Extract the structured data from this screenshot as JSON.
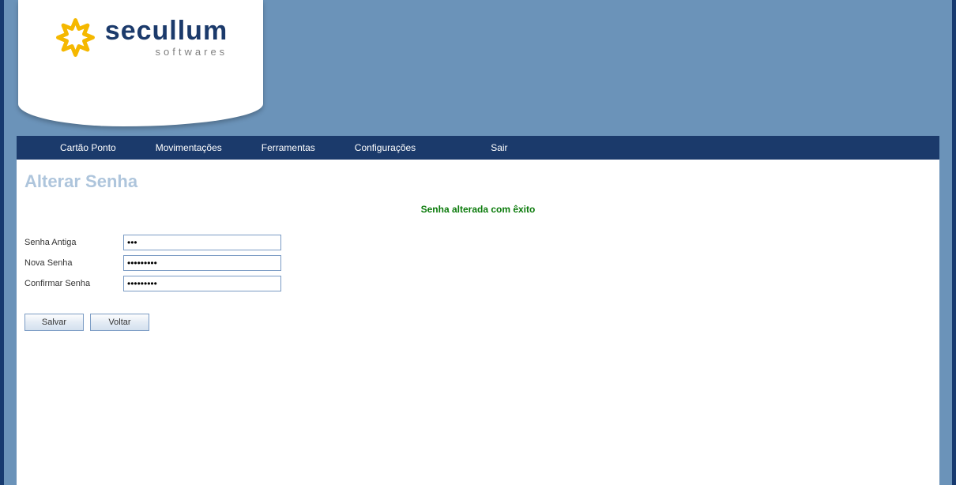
{
  "logo": {
    "main": "secullum",
    "sub": "softwares"
  },
  "nav": {
    "items": [
      "Cartão Ponto",
      "Movimentações",
      "Ferramentas",
      "Configurações",
      "Sair"
    ]
  },
  "page": {
    "title": "Alterar Senha",
    "successMessage": "Senha alterada com êxito"
  },
  "form": {
    "oldPasswordLabel": "Senha Antiga",
    "oldPasswordValue": "123",
    "newPasswordLabel": "Nova Senha",
    "newPasswordValue": "123456789",
    "confirmPasswordLabel": "Confirmar Senha",
    "confirmPasswordValue": "123456789"
  },
  "buttons": {
    "save": "Salvar",
    "back": "Voltar"
  }
}
